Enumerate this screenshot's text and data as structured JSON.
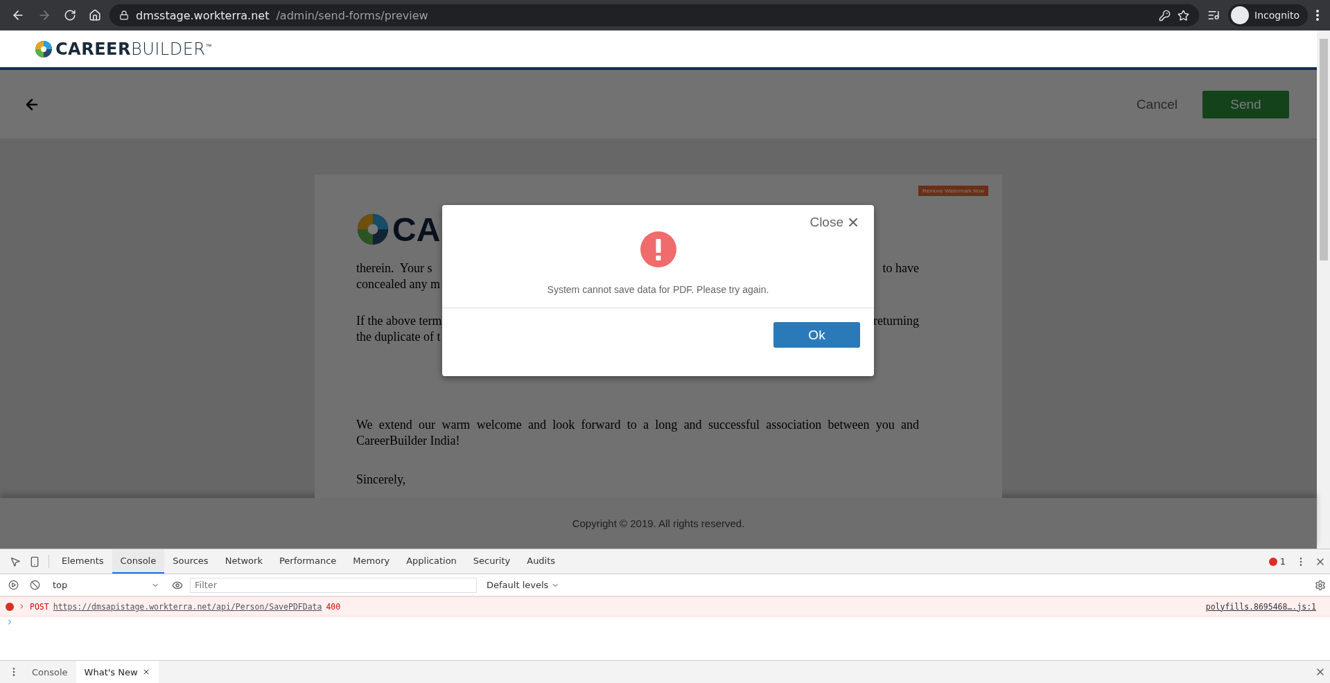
{
  "browser": {
    "url_host": "dmsstage.workterra.net",
    "url_path": "/admin/send-forms/preview",
    "profile": "Incognito",
    "forward_disabled": true
  },
  "header": {
    "logo": "**CAREER**BUILDER$^{™}$"
  },
  "toolbar": {
    "cancel": "Cancel",
    "send": "Send"
  },
  "document": {
    "watermark": "Remove Watermark Now",
    "logo_text": "CA",
    "lines": [
      {
        "left": "therein.  Your s",
        "right": "to have"
      },
      {
        "left": "concealed any m"
      },
      {
        "left": "If the above term",
        "right": "returning"
      },
      {
        "left": "the duplicate of t"
      }
    ],
    "paragraphs": [
      "We extend our warm welcome and look forward to a long and successful association between you and CareerBuilder India!",
      "Sincerely,"
    ]
  },
  "footer": {
    "copyright": "Copyright © 2019. All rights reserved."
  },
  "dialog": {
    "close_label": "Close",
    "message": "System cannot save data for PDF. Please try again.",
    "ok": "Ok"
  },
  "devtools": {
    "tabs": [
      {
        "label": "Elements",
        "selected": false
      },
      {
        "label": "Console",
        "selected": true
      },
      {
        "label": "Sources",
        "selected": false
      },
      {
        "label": "Network",
        "selected": false
      },
      {
        "label": "Performance",
        "selected": false
      },
      {
        "label": "Memory",
        "selected": false
      },
      {
        "label": "Application",
        "selected": false
      },
      {
        "label": "Security",
        "selected": false
      },
      {
        "label": "Audits",
        "selected": false
      }
    ],
    "error_count": "1",
    "context": "top",
    "filter_placeholder": "Filter",
    "levels": "Default levels",
    "messages": [
      {
        "kind": "error",
        "method": "POST",
        "url": "https://dmsapistage.workterra.net/api/Person/SavePDFData",
        "status": "400",
        "source": "polyfills.8695468….js:1"
      }
    ],
    "drawer_tabs": [
      {
        "label": "Console",
        "selected": false,
        "closable": false
      },
      {
        "label": "What's New",
        "selected": true,
        "closable": true
      }
    ]
  }
}
